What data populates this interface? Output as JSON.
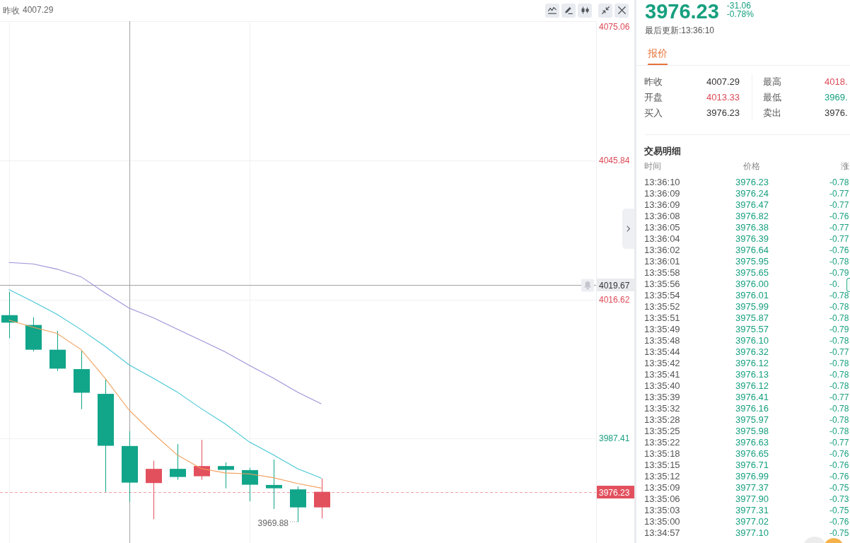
{
  "chart": {
    "prev_close": {
      "label": "昨收",
      "value": "4007.29"
    },
    "chart_data": [
      {
        "type": "candlestick",
        "categories": [
          null,
          null,
          null,
          null,
          null,
          null,
          null,
          null,
          null,
          null,
          null,
          null,
          null,
          null
        ],
        "ohlc": [
          [
            4013.33,
            4018.25,
            4008.49,
            4011.76
          ],
          [
            4011.27,
            4012.9,
            4005.72,
            4006.07
          ],
          [
            4006.07,
            4010.03,
            4001.61,
            4002.1
          ],
          [
            4002.0,
            4005.92,
            3993.58,
            3997.04
          ],
          [
            3996.8,
            3999.78,
            3976.19,
            3985.9
          ],
          [
            3985.85,
            3988.97,
            3974.1,
            3978.16
          ],
          [
            3978.07,
            3982.77,
            3970.49,
            3981.05
          ],
          [
            3981.05,
            3986.25,
            3978.76,
            3979.35
          ],
          [
            3979.5,
            3987.14,
            3978.76,
            3981.64
          ],
          [
            3981.64,
            3982.43,
            3976.97,
            3980.84
          ],
          [
            3980.79,
            3981.29,
            3974.25,
            3977.72
          ],
          [
            3977.67,
            3983.02,
            3972.62,
            3976.97
          ],
          [
            3976.74,
            3977.33,
            3969.88,
            3972.96
          ],
          [
            3972.96,
            3979.06,
            3970.64,
            3976.23
          ]
        ],
        "series": [
          {
            "type": "line",
            "color": "#f2a05e",
            "values": [
              4012.3,
              4010.8,
              4009.5,
              4006.1,
              4000.1,
              3993.4,
              3988.5,
              3984.0,
              3981.1,
              3980.2,
              3980.0,
              3979.2,
              3978.0,
              3977.0
            ]
          },
          {
            "type": "line",
            "color": "#45c6d6",
            "values": [
              4018.7,
              4016.2,
              4013.5,
              4010.3,
              4006.8,
              4002.9,
              4000.1,
              3997.2,
              3993.7,
              3990.5,
              3986.7,
              3984.0,
              3981.1,
              3979.1
            ]
          },
          {
            "type": "line",
            "color": "#9d92d8",
            "values": [
              4024.4,
              4024.1,
              4023.0,
              4021.4,
              4018.0,
              4014.8,
              4012.8,
              4010.4,
              4008.0,
              4005.6,
              4002.8,
              4000.1,
              3997.2,
              3994.7
            ]
          }
        ],
        "ylim": [
          3965.48,
          4075.06
        ],
        "yticks": [
          3987.41,
          4016.62,
          4045.84,
          4075.06
        ],
        "grid": true,
        "ref_lines": [
          {
            "axis": "y",
            "value": 4019.67,
            "label": "4019.67",
            "color": "#a3a3a3",
            "line_style": "solid"
          },
          {
            "axis": "y",
            "value": 3976.23,
            "label": "3976.23",
            "color": "#e2505e",
            "line_style": "dashed"
          }
        ],
        "annotations": [
          "3969.88"
        ]
      }
    ]
  },
  "quote": {
    "last_price": "3976.23",
    "change": "-31.06",
    "change_percent": "-0.78%",
    "updated": "最后更新:13:36:10",
    "tabs": [
      {
        "label": "报价",
        "selected": true
      }
    ],
    "stats": [
      [
        {
          "label": "昨收",
          "value": "4007.29",
          "color": "#333333"
        },
        {
          "label": "开盘",
          "value": "4013.33",
          "color": "#dc4a57"
        },
        {
          "label": "买入",
          "value": "3976.23",
          "color": "#333333"
        }
      ],
      [
        {
          "label": "最高",
          "value": "4018.",
          "color": "#dc4a57"
        },
        {
          "label": "最低",
          "value": "3969.",
          "color": "#17a07f"
        },
        {
          "label": "卖出",
          "value": "3976.",
          "color": "#333333"
        }
      ]
    ]
  },
  "trades": {
    "title": "交易明细",
    "columns": [
      "时间",
      "价格",
      "涨"
    ],
    "rows": [
      {
        "time": "13:36:10",
        "price": "3976.23",
        "change": "-0.78"
      },
      {
        "time": "13:36:09",
        "price": "3976.24",
        "change": "-0.77"
      },
      {
        "time": "13:36:09",
        "price": "3976.47",
        "change": "-0.77"
      },
      {
        "time": "13:36:08",
        "price": "3976.82",
        "change": "-0.76"
      },
      {
        "time": "13:36:05",
        "price": "3976.38",
        "change": "-0.77"
      },
      {
        "time": "13:36:04",
        "price": "3976.39",
        "change": "-0.77"
      },
      {
        "time": "13:36:02",
        "price": "3976.64",
        "change": "-0.76"
      },
      {
        "time": "13:36:01",
        "price": "3975.95",
        "change": "-0.78"
      },
      {
        "time": "13:35:58",
        "price": "3975.65",
        "change": "-0.79"
      },
      {
        "time": "13:35:56",
        "price": "3976.00",
        "change": "-0."
      },
      {
        "time": "13:35:54",
        "price": "3976.01",
        "change": "-0.78"
      },
      {
        "time": "13:35:52",
        "price": "3975.99",
        "change": "-0.78"
      },
      {
        "time": "13:35:51",
        "price": "3975.87",
        "change": "-0.78"
      },
      {
        "time": "13:35:49",
        "price": "3975.57",
        "change": "-0.79"
      },
      {
        "time": "13:35:48",
        "price": "3976.10",
        "change": "-0.78"
      },
      {
        "time": "13:35:44",
        "price": "3976.32",
        "change": "-0.77"
      },
      {
        "time": "13:35:42",
        "price": "3976.12",
        "change": "-0.78"
      },
      {
        "time": "13:35:41",
        "price": "3976.13",
        "change": "-0.78"
      },
      {
        "time": "13:35:40",
        "price": "3976.12",
        "change": "-0.78"
      },
      {
        "time": "13:35:39",
        "price": "3976.41",
        "change": "-0.77"
      },
      {
        "time": "13:35:32",
        "price": "3976.16",
        "change": "-0.78"
      },
      {
        "time": "13:35:28",
        "price": "3975.97",
        "change": "-0.78"
      },
      {
        "time": "13:35:25",
        "price": "3975.98",
        "change": "-0.78"
      },
      {
        "time": "13:35:22",
        "price": "3976.63",
        "change": "-0.77"
      },
      {
        "time": "13:35:18",
        "price": "3976.65",
        "change": "-0.76"
      },
      {
        "time": "13:35:15",
        "price": "3976.71",
        "change": "-0.76"
      },
      {
        "time": "13:35:12",
        "price": "3976.99",
        "change": "-0.76"
      },
      {
        "time": "13:35:09",
        "price": "3977.37",
        "change": "-0.75"
      },
      {
        "time": "13:35:06",
        "price": "3977.90",
        "change": "-0.73"
      },
      {
        "time": "13:35:03",
        "price": "3977.31",
        "change": "-0.75"
      },
      {
        "time": "13:35:00",
        "price": "3977.02",
        "change": "-0.76"
      },
      {
        "time": "13:34:57",
        "price": "3977.10",
        "change": "-0.75"
      }
    ]
  }
}
